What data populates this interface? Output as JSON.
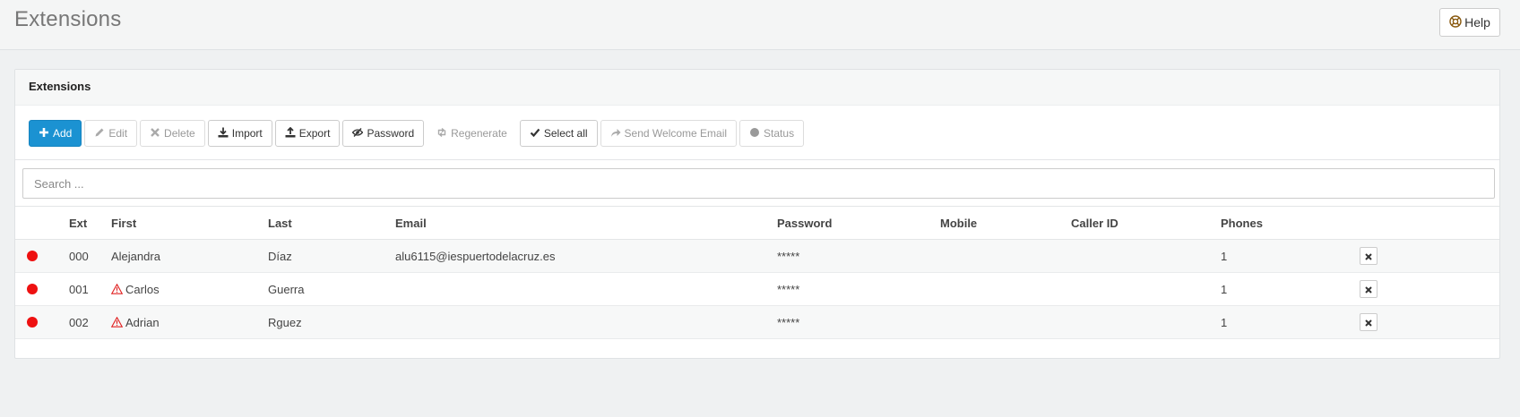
{
  "page": {
    "title": "Extensions",
    "help_label": "Help"
  },
  "panel": {
    "title": "Extensions"
  },
  "toolbar": {
    "add": "Add",
    "edit": "Edit",
    "delete": "Delete",
    "import": "Import",
    "export": "Export",
    "password": "Password",
    "regenerate": "Regenerate",
    "select_all": "Select all",
    "send_welcome_email": "Send Welcome Email",
    "status": "Status"
  },
  "search": {
    "placeholder": "Search ...",
    "value": ""
  },
  "table": {
    "headers": {
      "ext": "Ext",
      "first": "First",
      "last": "Last",
      "email": "Email",
      "password": "Password",
      "mobile": "Mobile",
      "caller_id": "Caller ID",
      "phones": "Phones"
    },
    "rows": [
      {
        "status_color": "#ee1111",
        "ext": "000",
        "first": "Alejandra",
        "warning": false,
        "last": "Díaz",
        "email": "alu6115@iespuertodelacruz.es",
        "password": "*****",
        "mobile": "",
        "caller_id": "",
        "phones": "1"
      },
      {
        "status_color": "#ee1111",
        "ext": "001",
        "first": "Carlos",
        "warning": true,
        "last": "Guerra",
        "email": "",
        "password": "*****",
        "mobile": "",
        "caller_id": "",
        "phones": "1"
      },
      {
        "status_color": "#ee1111",
        "ext": "002",
        "first": "Adrian",
        "warning": true,
        "last": "Rguez",
        "email": "",
        "password": "*****",
        "mobile": "",
        "caller_id": "",
        "phones": "1"
      }
    ]
  },
  "colors": {
    "accent": "#1b92d2",
    "status_offline": "#ee1111",
    "warning": "#e02020"
  },
  "icons": [
    "lifebuoy-icon",
    "plus-icon",
    "pencil-icon",
    "times-icon",
    "download-icon",
    "upload-icon",
    "eye-slash-icon",
    "retweet-icon",
    "check-icon",
    "share-icon",
    "circle-icon",
    "warning-icon",
    "close-icon"
  ]
}
